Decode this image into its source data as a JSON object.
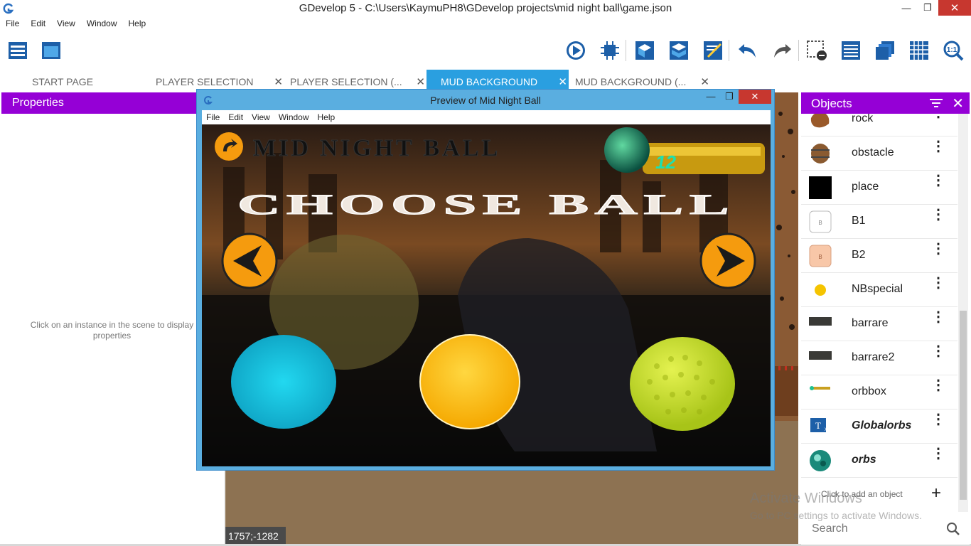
{
  "window": {
    "title": "GDevelop 5 - C:\\Users\\KaymuPH8\\GDevelop projects\\mid night ball\\game.json",
    "minimize": "—",
    "maximize": "❐",
    "close": "✕"
  },
  "menu": [
    "File",
    "Edit",
    "View",
    "Window",
    "Help"
  ],
  "tabs": [
    {
      "label": "START PAGE",
      "active": false,
      "closable": false
    },
    {
      "label": "PLAYER SELECTION",
      "active": false,
      "closable": true
    },
    {
      "label": "PLAYER SELECTION (...",
      "active": false,
      "closable": true
    },
    {
      "label": "MUD BACKGROUND",
      "active": true,
      "closable": true
    },
    {
      "label": "MUD BACKGROUND (...",
      "active": false,
      "closable": true
    }
  ],
  "tab_close": "✕",
  "properties": {
    "title": "Properties",
    "hint": "Click on an instance in the scene to display properties"
  },
  "scene": {
    "coords": "1757;-1282"
  },
  "objects": {
    "title": "Objects",
    "items": [
      {
        "name": "rock",
        "icon": "rock-icon",
        "bold": false
      },
      {
        "name": "obstacle",
        "icon": "barrel-icon",
        "bold": false
      },
      {
        "name": "place",
        "icon": "black-square-icon",
        "bold": false
      },
      {
        "name": "B1",
        "icon": "button-b1-icon",
        "bold": false
      },
      {
        "name": "B2",
        "icon": "button-b2-icon",
        "bold": false
      },
      {
        "name": "NBspecial",
        "icon": "yellow-ball-icon",
        "bold": false
      },
      {
        "name": "barrare",
        "icon": "bar-icon",
        "bold": false
      },
      {
        "name": "barrare2",
        "icon": "bar-icon",
        "bold": false
      },
      {
        "name": "orbbox",
        "icon": "orbbox-icon",
        "bold": false
      },
      {
        "name": "Globalorbs",
        "icon": "text-object-icon",
        "bold": true
      },
      {
        "name": "orbs",
        "icon": "orb-icon",
        "bold": true
      }
    ],
    "add_label": "Click to add an object",
    "search_placeholder": "Search"
  },
  "watermark": {
    "line1": "Activate Windows",
    "line2": "Go to PC settings to activate Windows."
  },
  "preview": {
    "title": "Preview of Mid Night Ball",
    "menu": [
      "File",
      "Edit",
      "View",
      "Window",
      "Help"
    ],
    "game": {
      "logo_text": "MID NIGHT BALL",
      "orb_count": "12",
      "heading": "CHOOSE BALL"
    }
  },
  "colors": {
    "accent_purple": "#9500d6",
    "active_tab": "#2a9fe0",
    "close_red": "#c7372f",
    "ball_cyan": "#19c6e0",
    "ball_yellow": "#ffc21a",
    "ball_green": "#c9e02a",
    "arrow_orange": "#f59b0e",
    "orb_count_green": "#1ee0b0"
  }
}
